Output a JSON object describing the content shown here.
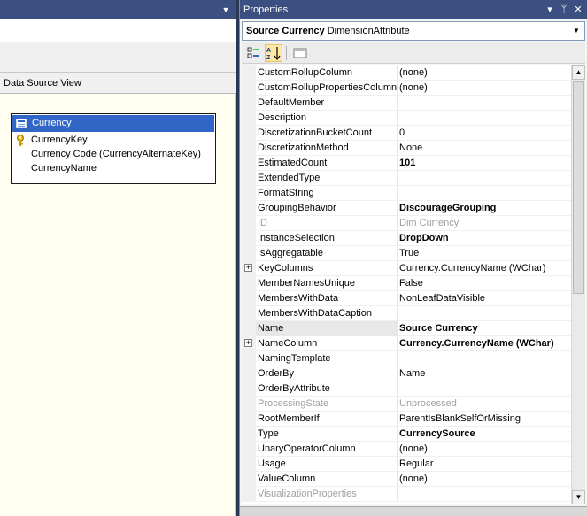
{
  "left": {
    "dsv_header": "Data Source View",
    "table": {
      "title": "Currency",
      "columns": [
        {
          "name": "CurrencyKey",
          "is_key": true
        },
        {
          "name": "Currency Code (CurrencyAlternateKey)",
          "is_key": false
        },
        {
          "name": "CurrencyName",
          "is_key": false
        }
      ]
    }
  },
  "properties": {
    "title": "Properties",
    "object_name": "Source Currency",
    "object_type": "DimensionAttribute",
    "rows": [
      {
        "name": "CustomRollupColumn",
        "value": "(none)",
        "style": "normal",
        "expandable": false
      },
      {
        "name": "CustomRollupPropertiesColumn",
        "value": "(none)",
        "style": "normal",
        "expandable": false
      },
      {
        "name": "DefaultMember",
        "value": "",
        "style": "normal",
        "expandable": false
      },
      {
        "name": "Description",
        "value": "",
        "style": "normal",
        "expandable": false
      },
      {
        "name": "DiscretizationBucketCount",
        "value": "0",
        "style": "normal",
        "expandable": false
      },
      {
        "name": "DiscretizationMethod",
        "value": "None",
        "style": "normal",
        "expandable": false
      },
      {
        "name": "EstimatedCount",
        "value": "101",
        "style": "bold",
        "expandable": false
      },
      {
        "name": "ExtendedType",
        "value": "",
        "style": "normal",
        "expandable": false
      },
      {
        "name": "FormatString",
        "value": "",
        "style": "normal",
        "expandable": false
      },
      {
        "name": "GroupingBehavior",
        "value": "DiscourageGrouping",
        "style": "bold",
        "expandable": false
      },
      {
        "name": "ID",
        "value": "Dim Currency",
        "style": "dim",
        "expandable": false
      },
      {
        "name": "InstanceSelection",
        "value": "DropDown",
        "style": "bold",
        "expandable": false
      },
      {
        "name": "IsAggregatable",
        "value": "True",
        "style": "normal",
        "expandable": false
      },
      {
        "name": "KeyColumns",
        "value": "Currency.CurrencyName (WChar)",
        "style": "normal",
        "expandable": true
      },
      {
        "name": "MemberNamesUnique",
        "value": "False",
        "style": "normal",
        "expandable": false
      },
      {
        "name": "MembersWithData",
        "value": "NonLeafDataVisible",
        "style": "normal",
        "expandable": false
      },
      {
        "name": "MembersWithDataCaption",
        "value": "",
        "style": "normal",
        "expandable": false
      },
      {
        "name": "Name",
        "value": "Source Currency",
        "style": "bold",
        "expandable": false,
        "selected": true
      },
      {
        "name": "NameColumn",
        "value": "Currency.CurrencyName (WChar)",
        "style": "bold",
        "expandable": true
      },
      {
        "name": "NamingTemplate",
        "value": "",
        "style": "normal",
        "expandable": false
      },
      {
        "name": "OrderBy",
        "value": "Name",
        "style": "normal",
        "expandable": false
      },
      {
        "name": "OrderByAttribute",
        "value": "",
        "style": "normal",
        "expandable": false
      },
      {
        "name": "ProcessingState",
        "value": "Unprocessed",
        "style": "dim",
        "expandable": false
      },
      {
        "name": "RootMemberIf",
        "value": "ParentIsBlankSelfOrMissing",
        "style": "normal",
        "expandable": false
      },
      {
        "name": "Type",
        "value": "CurrencySource",
        "style": "bold",
        "expandable": false
      },
      {
        "name": "UnaryOperatorColumn",
        "value": "(none)",
        "style": "normal",
        "expandable": false
      },
      {
        "name": "Usage",
        "value": "Regular",
        "style": "normal",
        "expandable": false
      },
      {
        "name": "ValueColumn",
        "value": "(none)",
        "style": "normal",
        "expandable": false
      },
      {
        "name": "VisualizationProperties",
        "value": "",
        "style": "dim",
        "expandable": false
      }
    ]
  },
  "colors": {
    "titlebar": "#3b4f81",
    "selection": "#3166c6",
    "canvas": "#fffef0"
  }
}
